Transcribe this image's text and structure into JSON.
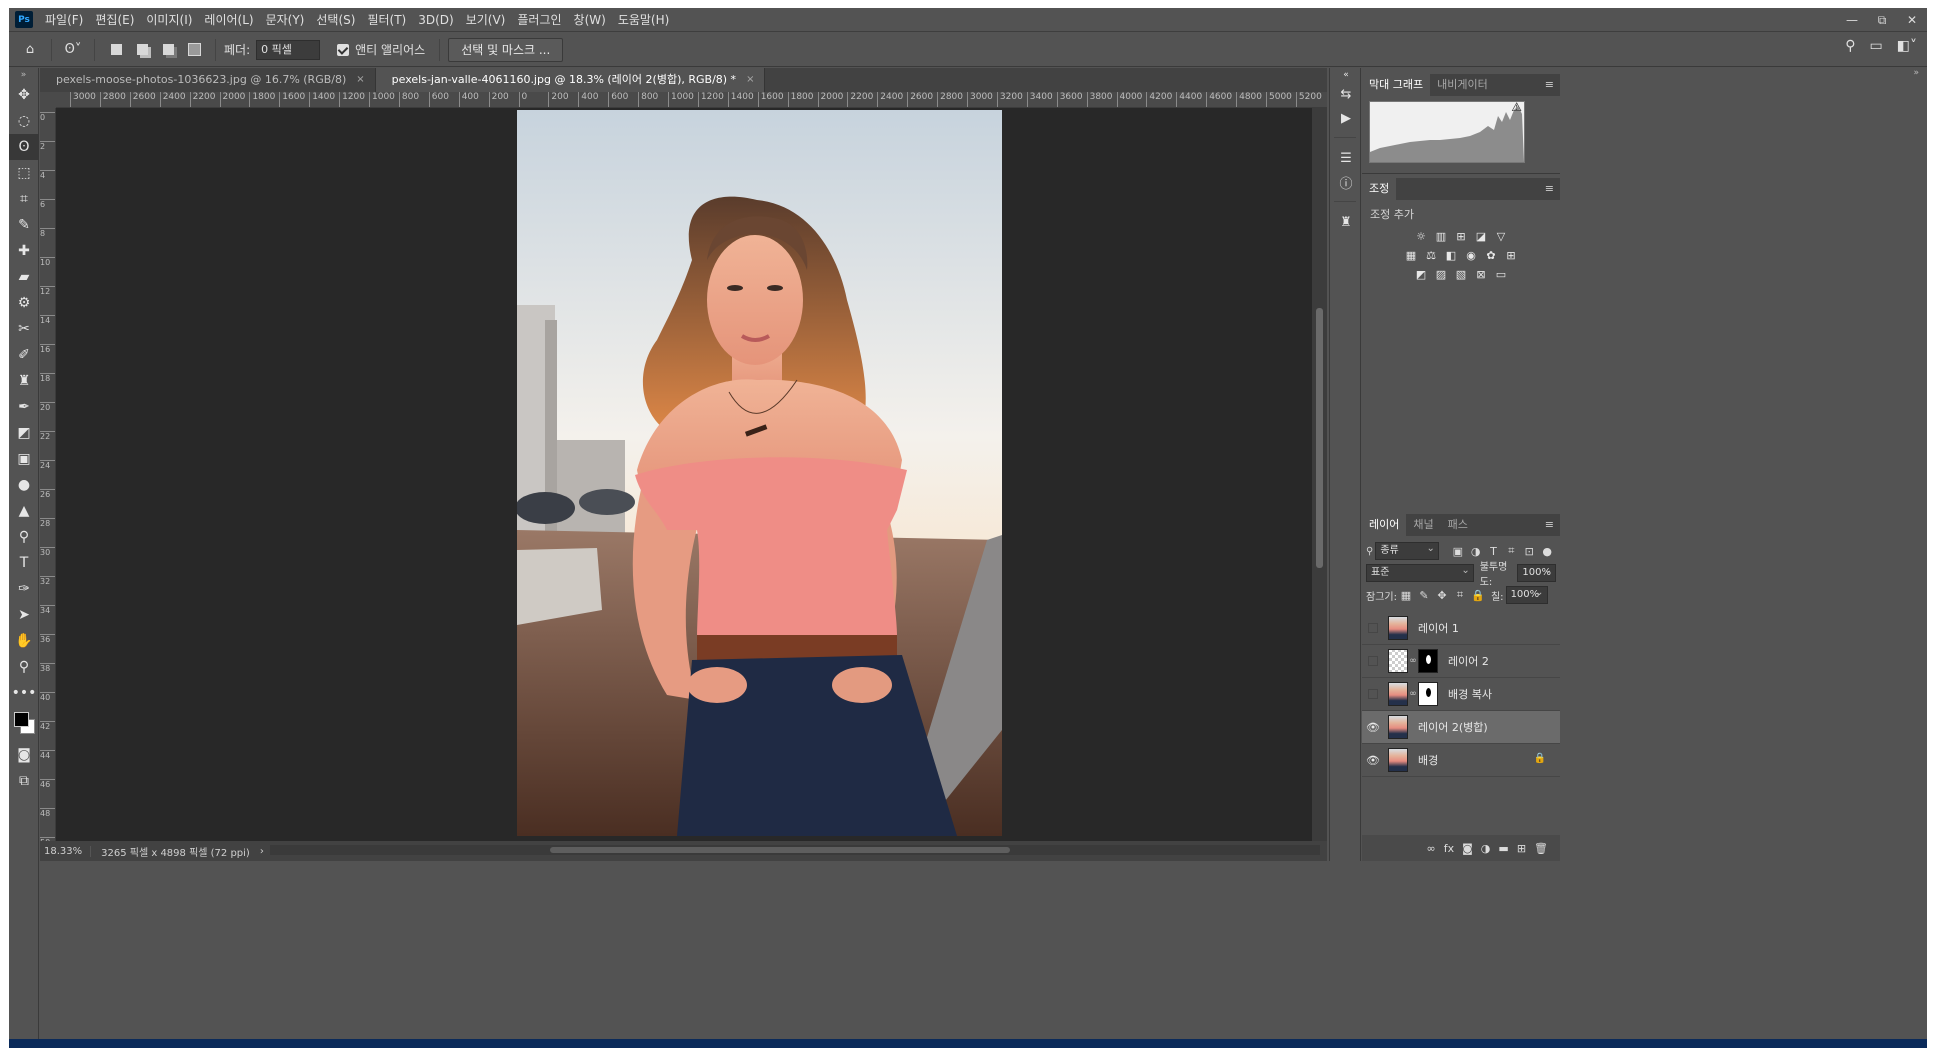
{
  "app": {
    "logo": "Ps"
  },
  "menu": [
    "파일(F)",
    "편집(E)",
    "이미지(I)",
    "레이어(L)",
    "문자(Y)",
    "선택(S)",
    "필터(T)",
    "3D(D)",
    "보기(V)",
    "플러그인",
    "창(W)",
    "도움말(H)"
  ],
  "window_controls": {
    "minimize": "—",
    "restore": "⧉",
    "close": "✕"
  },
  "options": {
    "feather_label": "페더:",
    "feather_value": "0 픽셀",
    "anti_alias_label": "앤티 앨리어스",
    "select_mask_button": "선택 및 마스크 ..."
  },
  "tabs": [
    {
      "label": "pexels-moose-photos-1036623.jpg @ 16.7% (RGB/8)",
      "close": "×"
    },
    {
      "label": "pexels-jan-valle-4061160.jpg @ 18.3% (레이어 2(병합), RGB/8) *",
      "close": "×"
    }
  ],
  "ruler": {
    "horizontal": [
      "3000",
      "2800",
      "2600",
      "2400",
      "2200",
      "2000",
      "1800",
      "1600",
      "1400",
      "1200",
      "1000",
      "800",
      "600",
      "400",
      "200",
      "0",
      "200",
      "400",
      "600",
      "800",
      "1000",
      "1200",
      "1400",
      "1600",
      "1800",
      "2000",
      "2200",
      "2400",
      "2600",
      "2800",
      "3000",
      "3200",
      "3400",
      "3600",
      "3800",
      "4000",
      "4200",
      "4400",
      "4600",
      "4800",
      "5000",
      "5200"
    ],
    "vertical": [
      "0",
      "2",
      "4",
      "6",
      "8",
      "10",
      "12",
      "14",
      "16",
      "18",
      "20",
      "22",
      "24",
      "26",
      "28",
      "30",
      "32",
      "34",
      "36",
      "38",
      "40",
      "42",
      "44",
      "46",
      "48",
      "50"
    ]
  },
  "status": {
    "zoom": "18.33%",
    "doc_info": "3265 픽셀 x 4898 픽셀 (72 ppi)",
    "arrow": "›"
  },
  "panels": {
    "histogram_tabs": [
      "막대 그래프",
      "내비게이터"
    ],
    "histogram_warning": "⚠",
    "adjust_tab": "조정",
    "adjust_label": "조정 추가",
    "layers_tabs": [
      "레이어",
      "채널",
      "패스"
    ],
    "filter_kind": "종류",
    "blend_mode": "표준",
    "opacity_label": "불투명도:",
    "opacity_value": "100%",
    "lock_label": "잠그기:",
    "fill_label": "칠:",
    "fill_value": "100%",
    "menu_icon": "≡"
  },
  "layers": [
    {
      "name": "레이어 1",
      "visible": false
    },
    {
      "name": "레이어 2",
      "visible": false
    },
    {
      "name": "배경 복사",
      "visible": false
    },
    {
      "name": "레이어 2(병합)",
      "visible": true,
      "selected": true
    },
    {
      "name": "배경",
      "visible": true,
      "locked": true
    }
  ]
}
